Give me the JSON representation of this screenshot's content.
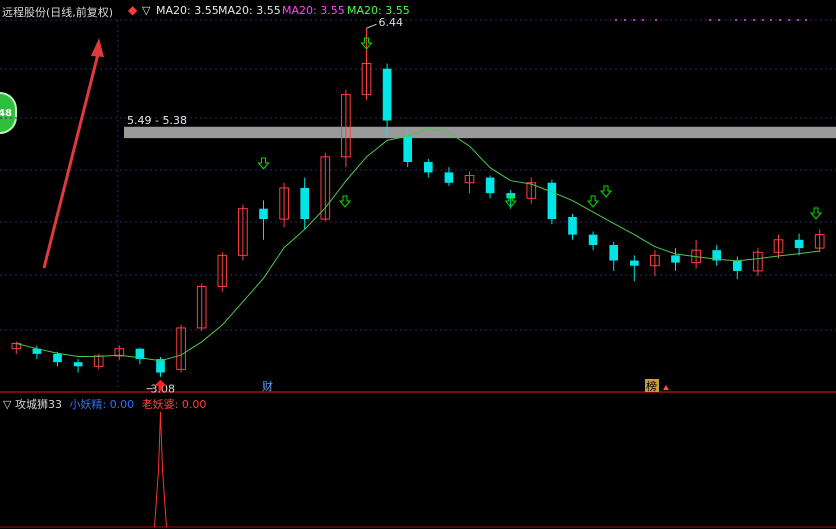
{
  "header": {
    "stock_title": "远程股份(日线,前复权)",
    "ma_label_1": "MA20: 3.55",
    "ma_label_2": "MA20: 3.55",
    "ma_label_3": "MA20: 3.55",
    "ma_label_4": "MA20: 3.55"
  },
  "side_badge": "48",
  "annotations": {
    "high_label": "6.44",
    "low_label": "3.08",
    "band_label": "5.49 - 5.38",
    "marker_cai": "财",
    "marker_bang": "榜"
  },
  "sub_panel": {
    "title": "攻城狮33",
    "field_1_label": "小妖精:",
    "field_1_value": "0.00",
    "field_2_label": "老妖婆:",
    "field_2_value": "0.00"
  },
  "colors": {
    "up": "#ff4040",
    "down": "#00e5e5",
    "ma_line": "#4cc84c",
    "band": "#9a9a9a",
    "grid": "#2a2a6a",
    "panel_border": "#9a1010",
    "arrow": "#e23a3a",
    "down_arrow_icon": "#00e000",
    "up_arrow_icon": "#ff2020"
  },
  "chart_data": {
    "type": "candlestick",
    "y_range": [
      3.0,
      6.5
    ],
    "band": [
      5.38,
      5.49
    ],
    "candles": [
      [
        3.35,
        3.4,
        3.3,
        3.42
      ],
      [
        3.35,
        3.3,
        3.25,
        3.38
      ],
      [
        3.3,
        3.22,
        3.18,
        3.32
      ],
      [
        3.22,
        3.18,
        3.12,
        3.25
      ],
      [
        3.18,
        3.28,
        3.15,
        3.3
      ],
      [
        3.28,
        3.35,
        3.24,
        3.38
      ],
      [
        3.35,
        3.25,
        3.2,
        3.36
      ],
      [
        3.25,
        3.12,
        3.08,
        3.27
      ],
      [
        3.15,
        3.55,
        3.12,
        3.58
      ],
      [
        3.55,
        3.95,
        3.52,
        3.98
      ],
      [
        3.95,
        4.25,
        3.9,
        4.28
      ],
      [
        4.25,
        4.7,
        4.2,
        4.74
      ],
      [
        4.7,
        4.6,
        4.4,
        4.78
      ],
      [
        4.6,
        4.9,
        4.52,
        4.95
      ],
      [
        4.9,
        4.6,
        4.5,
        5.0
      ],
      [
        4.6,
        5.2,
        4.58,
        5.24
      ],
      [
        5.2,
        5.8,
        5.1,
        5.85
      ],
      [
        5.8,
        6.1,
        5.75,
        6.44
      ],
      [
        6.05,
        5.55,
        5.38,
        6.1
      ],
      [
        5.4,
        5.15,
        5.1,
        5.45
      ],
      [
        5.15,
        5.05,
        5.0,
        5.18
      ],
      [
        5.05,
        4.95,
        4.92,
        5.1
      ],
      [
        4.95,
        5.02,
        4.85,
        5.06
      ],
      [
        5.0,
        4.85,
        4.8,
        5.02
      ],
      [
        4.85,
        4.8,
        4.7,
        4.88
      ],
      [
        4.8,
        4.95,
        4.75,
        5.0
      ],
      [
        4.95,
        4.6,
        4.55,
        4.98
      ],
      [
        4.62,
        4.45,
        4.4,
        4.65
      ],
      [
        4.45,
        4.35,
        4.3,
        4.48
      ],
      [
        4.35,
        4.2,
        4.1,
        4.38
      ],
      [
        4.2,
        4.15,
        4.0,
        4.25
      ],
      [
        4.15,
        4.25,
        4.05,
        4.3
      ],
      [
        4.25,
        4.18,
        4.1,
        4.32
      ],
      [
        4.18,
        4.3,
        4.12,
        4.4
      ],
      [
        4.3,
        4.2,
        4.15,
        4.35
      ],
      [
        4.2,
        4.1,
        4.02,
        4.24
      ],
      [
        4.1,
        4.28,
        4.05,
        4.32
      ],
      [
        4.28,
        4.4,
        4.22,
        4.45
      ],
      [
        4.4,
        4.32,
        4.25,
        4.46
      ],
      [
        4.32,
        4.45,
        4.28,
        4.5
      ]
    ]
  }
}
